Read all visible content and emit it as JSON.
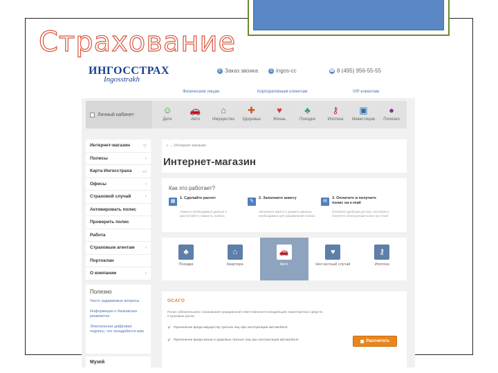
{
  "slide": {
    "title": "Страхование"
  },
  "site": {
    "logo_main": "ИНГОССТРАХ",
    "logo_sub": "Ingosstrakh",
    "contacts": [
      {
        "icon": "phone-icon",
        "glyph": "✆",
        "label": "Заказ звонка"
      },
      {
        "icon": "skype-icon",
        "glyph": "S",
        "label": "ingos-cc"
      },
      {
        "icon": "call-icon",
        "glyph": "☎",
        "label": "8 (495) 956-55-55"
      }
    ],
    "top_links": [
      "Физическим лицам",
      "Корпоративным клиентам",
      "VIP-клиентам"
    ],
    "cabinet_label": "Личный кабинет",
    "categories": [
      {
        "label": "Дети",
        "icon": "kids-icon",
        "glyph": "☺",
        "color": "#3d9a3a"
      },
      {
        "label": "Авто",
        "icon": "car-icon",
        "glyph": "🚗",
        "color": "#e0901f"
      },
      {
        "label": "Имущество",
        "icon": "house-icon",
        "glyph": "⌂",
        "color": "#d04a2a"
      },
      {
        "label": "Здоровье",
        "icon": "health-icon",
        "glyph": "✚",
        "color": "#c25a1c"
      },
      {
        "label": "Жизнь",
        "icon": "heart-icon",
        "glyph": "♥",
        "color": "#d23a4a"
      },
      {
        "label": "Поездки",
        "icon": "palm-icon",
        "glyph": "♣",
        "color": "#3aa36a"
      },
      {
        "label": "Ипотека",
        "icon": "keys-icon",
        "glyph": "⚷",
        "color": "#c0302a"
      },
      {
        "label": "Инвестиции",
        "icon": "briefcase-icon",
        "glyph": "▣",
        "color": "#2b6fb0"
      },
      {
        "label": "Полезно",
        "icon": "piggy-icon",
        "glyph": "●",
        "color": "#7a3a8a"
      }
    ],
    "sidebar": [
      {
        "label": "Интернет-магазин",
        "mark": "▽"
      },
      {
        "label": "Полисы",
        "mark": "›"
      },
      {
        "label": "Карта Ингосстраха",
        "mark": "▭"
      },
      {
        "label": "Офисы",
        "mark": "›"
      },
      {
        "label": "Страховой случай",
        "mark": "›"
      },
      {
        "label": "Активировать полис",
        "mark": ""
      },
      {
        "label": "Проверить полис",
        "mark": ""
      },
      {
        "label": "Работа",
        "mark": ""
      },
      {
        "label": "Страховым агентам",
        "mark": "›"
      },
      {
        "label": "Портоклан",
        "mark": ""
      },
      {
        "label": "О компании",
        "mark": "›"
      }
    ],
    "useful": {
      "heading": "Полезно",
      "links": [
        "Часто задаваемые вопросы",
        "Информация о банковских реквизитах",
        "Электронная цифровая подпись, что понадобится вам"
      ]
    },
    "museum_label": "Музей",
    "breadcrumb": "⌂ → Интернет-магазин",
    "page_title": "Интернет-магазин",
    "how": {
      "title": "Как это работает?",
      "steps": [
        {
          "glyph": "▦",
          "title": "1. Сделайте расчет",
          "desc": "Укажите необходимые данные и рассчитайте стоимость полиса"
        },
        {
          "glyph": "✎",
          "title": "2. Заполните анкету",
          "desc": "Заполните анкету и укажите данные, необходимые для оформления полиса"
        },
        {
          "glyph": "✉",
          "title": "3. Оплатите и получите полис на e-mail",
          "desc": "Оплатите удобным для вас способом и получите электронный полис на e-mail"
        }
      ]
    },
    "products": [
      {
        "label": "Поездки",
        "glyph": "♣",
        "active": false
      },
      {
        "label": "Квартира",
        "glyph": "⌂",
        "active": false
      },
      {
        "label": "Авто",
        "glyph": "🚗",
        "active": true
      },
      {
        "label": "Несчастный случай",
        "glyph": "♥",
        "active": false
      },
      {
        "label": "Ипотека",
        "glyph": "⚷",
        "active": false
      }
    ],
    "osago": {
      "title": "ОСАГО",
      "desc": "Полис обязательного страхования гражданской ответственности владельцев транспортных средств. Страховые риски:",
      "items": [
        "Причинение вреда имуществу третьих лиц при эксплуатации автомобиля",
        "Причинение вреда жизни и здоровью третьих лиц при эксплуатации автомобиля"
      ],
      "button_label": "Рассчитать",
      "button_glyph": "▦"
    }
  }
}
